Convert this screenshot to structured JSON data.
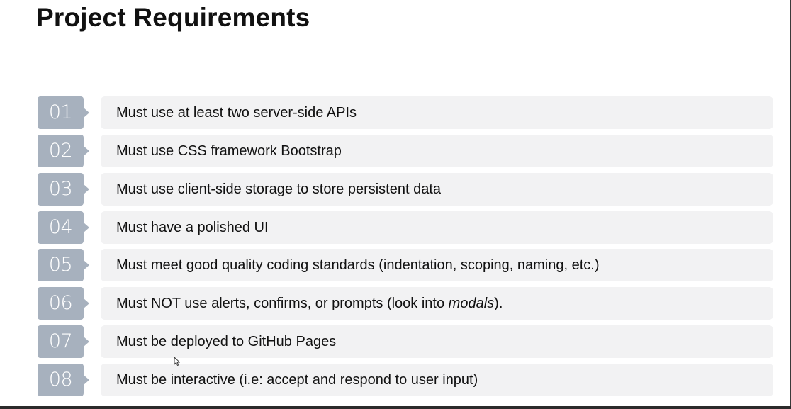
{
  "slide": {
    "title": "Project Requirements"
  },
  "requirements": [
    {
      "number": "01",
      "text": "Must use at least two server-side APIs"
    },
    {
      "number": "02",
      "text": "Must use CSS framework Bootstrap"
    },
    {
      "number": "03",
      "text": "Must use client-side storage to store persistent data"
    },
    {
      "number": "04",
      "text": "Must have a polished UI"
    },
    {
      "number": "05",
      "text": "Must meet good quality coding standards (indentation, scoping, naming, etc.)"
    },
    {
      "number": "06",
      "text_before": "Must NOT use alerts, confirms, or prompts (look into ",
      "text_emphasis": "modals",
      "text_after": ")."
    },
    {
      "number": "07",
      "text": "Must be deployed to GitHub Pages"
    },
    {
      "number": "08",
      "text": "Must be interactive (i.e: accept and respond to user input)"
    }
  ],
  "colors": {
    "number_badge": "#a7b1be",
    "row_background": "#f2f2f3",
    "title_text": "#111111",
    "rule": "#8a8a94"
  },
  "icons": {
    "cursor": "mouse-pointer-icon"
  }
}
